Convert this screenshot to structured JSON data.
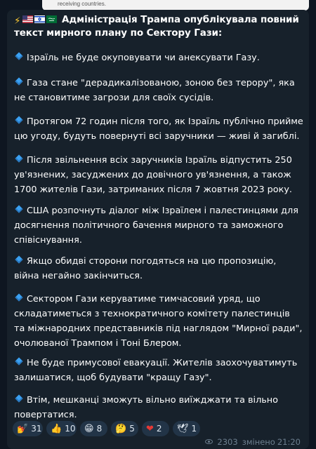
{
  "prev_message": {
    "text": "receiving countries."
  },
  "post": {
    "title": "Адміністрація Трампа опублікувала повний текст мирного плану по Сектору Гази:",
    "title_icons": [
      "lightning-icon",
      "us-flag-icon",
      "israel-flag-icon",
      "saudi-flag-icon"
    ],
    "bullet_icon": "blue-diamond-icon",
    "paragraphs": [
      "Ізраїль не буде окуповувати чи анексувати Газу.",
      "Газа стане \"дерадикалізованою, зоною без терору\", яка не становитиме загрози для своїх сусідів.",
      "Протягом 72 годин після того, як Ізраїль публічно прийме цю угоду, будуть повернуті всі заручники — живі й загиблі.",
      "Після звільнення всіх заручників Ізраїль відпустить 250 ув'язнених, засуджених до довічного ув'язнення, а також 1700 жителів Гази, затриманих після 7 жовтня 2023 року.",
      "США розпочнуть діалог між Ізраїлем і палестинцями для досягнення політичного бачення мирного та заможного співіснування.",
      "Якщо обидві сторони погодяться на цю пропозицію, війна негайно закінчиться.",
      "Сектором Гази керуватиме тимчасовий уряд, що складатиметься з технократичного комітету палестинців та міжнародних представників під наглядом \"Мирної ради\", очолюваної Трампом і Тоні Блером.",
      "Не буде примусової евакуації. Жителів заохочуватимуть залишатися, щоб будувати \"кращу Газу\".",
      "Втім, мешканці зможуть вільно виїжджати та вільно повертатися."
    ]
  },
  "reactions": [
    {
      "emoji": "💅",
      "icon": "nail-polish-icon",
      "count": "31"
    },
    {
      "emoji": "👍",
      "icon": "thumbs-up-icon",
      "count": "10"
    },
    {
      "emoji": "😁",
      "icon": "grin-icon",
      "count": "8"
    },
    {
      "emoji": "🤔",
      "icon": "thinking-icon",
      "count": "5"
    },
    {
      "emoji": "❤",
      "icon": "heart-icon",
      "count": "2"
    },
    {
      "emoji": "🕊",
      "icon": "dove-icon",
      "count": "1"
    }
  ],
  "meta": {
    "views": "2303",
    "edited_label": "змінено",
    "time": "21:20"
  },
  "colors": {
    "background": "#0e1621",
    "bubble": "#17212b",
    "reaction_bg": "#223447",
    "meta_text": "#6d7f8f",
    "bullet": "#3ba1f2"
  }
}
